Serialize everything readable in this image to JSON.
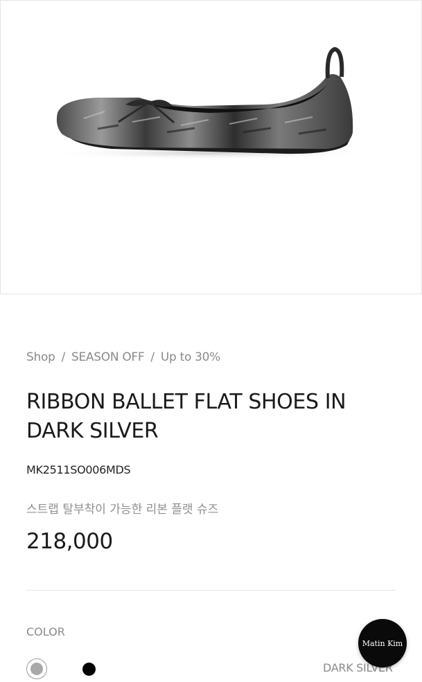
{
  "product_image": {
    "alt": "ribbon-ballet-flat-dark-silver"
  },
  "breadcrumb": {
    "items": [
      "Shop",
      "SEASON OFF",
      "Up to 30%"
    ],
    "separator": "/"
  },
  "product": {
    "title": "RIBBON BALLET FLAT SHOES IN DARK SILVER",
    "code": "MK2511SO006MDS",
    "subtitle": "스트랩 탈부착이 가능한 리본 플랫 슈즈",
    "price": "218,000"
  },
  "color": {
    "label": "COLOR",
    "selected": "DARK SILVER",
    "options": [
      {
        "name": "DARK SILVER",
        "hex": "#a9a9a9"
      },
      {
        "name": "BLACK",
        "hex": "#000000"
      }
    ]
  },
  "brand_button": {
    "label": "Matin  Kim"
  }
}
